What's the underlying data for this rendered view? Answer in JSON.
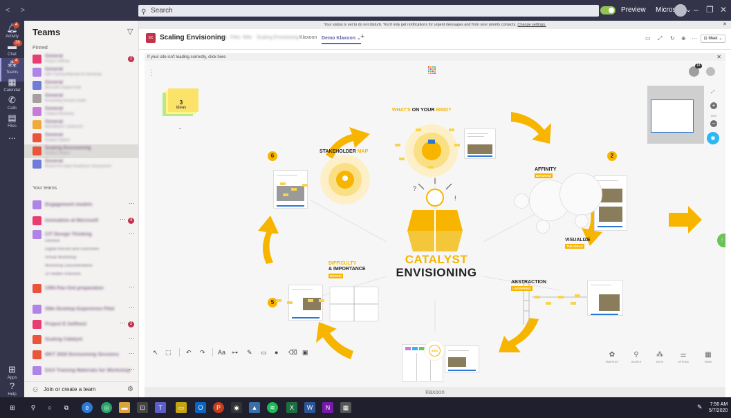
{
  "titlebar": {
    "search_placeholder": "Search",
    "preview_label": "Preview",
    "org_label": "Microsoft ⌄",
    "minimize": "–",
    "maximize": "❐",
    "close": "✕"
  },
  "rail": {
    "items": [
      {
        "label": "Activity",
        "badge": "4"
      },
      {
        "label": "Chat",
        "badge": "36"
      },
      {
        "label": "Teams",
        "badge": "4"
      },
      {
        "label": "Calendar"
      },
      {
        "label": "Calls"
      },
      {
        "label": "Files"
      },
      {
        "label": "..."
      },
      {
        "label": "Apps"
      },
      {
        "label": "Help"
      }
    ]
  },
  "teams_panel": {
    "title": "Teams",
    "pinned_label": "Pinned",
    "your_teams_label": "Your teams",
    "pinned": [
      {
        "name": "General",
        "sub": "Project Coffman",
        "color": "#e83c72",
        "badge": "2"
      },
      {
        "name": "General",
        "sub": "DAX Training Materials for Workshop",
        "color": "#b083e8"
      },
      {
        "name": "General",
        "sub": "Microsoft Catalyst Suite",
        "color": "#6e7bd9"
      },
      {
        "name": "General",
        "sub": "Envisioning Session Guide",
        "color": "#a79f9f"
      },
      {
        "name": "General",
        "sub": "Catalyst Workshop",
        "color": "#c77dd8"
      },
      {
        "name": "General",
        "sub": "MOONSHOT CATALYST",
        "color": "#f2a93b"
      },
      {
        "name": "General",
        "sub": "Scaling Catalyst",
        "color": "#e8543c"
      },
      {
        "name": "Scaling Envisioning",
        "sub": "Scaling Catalyst",
        "color": "#e8543c",
        "selected": true
      },
      {
        "name": "General",
        "sub": "Review Pre-Sales Readiness / Assessment",
        "color": "#6e7bd9"
      }
    ],
    "teams": [
      {
        "name": "Engagement models",
        "color": "#b083e8",
        "more": "···"
      },
      {
        "name": "Innovation at Microsoft",
        "color": "#e83c72",
        "more": "···",
        "badge": "4"
      },
      {
        "name": "CIT Design Thinking",
        "color": "#b083e8",
        "more": "···"
      },
      {
        "name": "CRN Pan Ord preparation",
        "color": "#e8543c",
        "more": "···"
      },
      {
        "name": "SMe Desktop Experience Pilot",
        "color": "#b083e8",
        "more": "···"
      },
      {
        "name": "Project E Selfhost",
        "color": "#e83c72",
        "more": "···",
        "badge": "2"
      },
      {
        "name": "Scaling Catalyst",
        "color": "#e8543c",
        "more": "···"
      },
      {
        "name": "MKT 2020 Envisioning Sessions",
        "color": "#e8543c",
        "more": "···"
      },
      {
        "name": "DAX Training Materials for Workshop",
        "color": "#b083e8",
        "more": "···"
      },
      {
        "name": "Microsoft Catalyst Suite",
        "color": "#6e7bd9",
        "more": "···"
      }
    ],
    "channels": [
      "General",
      "Digital Record and Outcomes",
      "Virtual Workshop",
      "Workshop Documentation",
      "10 hidden channels"
    ],
    "join_label": "Join or create a team"
  },
  "status_bar": {
    "message": "Your status is set to do not disturb. You'll only get notifications for urgent messages and from your priority contacts.",
    "link": "Change settings."
  },
  "channel_header": {
    "avatar": "SC",
    "name": "Scaling Envisioning",
    "tabs": [
      {
        "label": "Posts",
        "blur": true
      },
      {
        "label": "Files",
        "blur": true
      },
      {
        "label": "Wiki",
        "blur": true
      },
      {
        "label": "Scaling Envisioning",
        "blur": true
      },
      {
        "label": "Klaxoon"
      },
      {
        "label": "Demo Klaxoon ⌄",
        "active": true
      },
      {
        "label": "+"
      }
    ],
    "meet_label": "Meet ⌄"
  },
  "load_bar": {
    "text": "If your site isn't loading correctly, click here"
  },
  "board": {
    "ideas_count": "3",
    "ideas_label": "ideas",
    "users_count": "14",
    "center_title_1": "CATALYST",
    "center_title_2": "ENVISIONING",
    "sections": {
      "whats_on_your_mind_1": "WHAT'S",
      "whats_on_your_mind_2": "ON YOUR",
      "whats_on_your_mind_3": "MIND?",
      "affinity_1": "AFFINITY",
      "affinity_2": "DIAGRAM",
      "visualize_1": "VISUALIZE",
      "visualize_2": "THE IDEAS",
      "abstraction_1": "ABSTRACTION",
      "abstraction_2": "LADDERING",
      "difficulty_1": "DIFFICULTY",
      "difficulty_2": "& IMPORTANCE",
      "difficulty_3": "MATRIX",
      "stakeholder_1": "STAKEHOLDER",
      "stakeholder_2": "MAP"
    },
    "numbers": [
      "2",
      "3",
      "5",
      "6"
    ],
    "zoom_level": "50%",
    "idea_button": "IDEA",
    "right_tools": [
      {
        "icon": "✿",
        "label": "SNAPSHOT"
      },
      {
        "icon": "⚲",
        "label": "SEARCH"
      },
      {
        "icon": "⁂",
        "label": "MOVE"
      },
      {
        "icon": "⚌",
        "label": "OPTIONS"
      },
      {
        "icon": "▦",
        "label": "VIEWS"
      }
    ],
    "footer": "klaxoon"
  },
  "taskbar": {
    "time": "7:56 AM",
    "date": "5/7/2020"
  },
  "colors": {
    "accent": "#6264a7",
    "klaxoon_yellow": "#f7b500",
    "rail": "#33344a"
  }
}
